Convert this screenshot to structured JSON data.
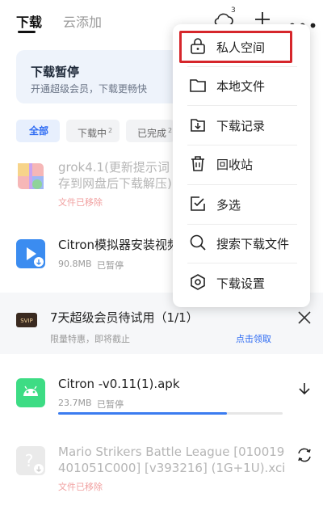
{
  "tabs": {
    "download": "下载",
    "cloud_add": "云添加"
  },
  "header": {
    "cloud_badge": "3"
  },
  "banner": {
    "title": "下载暂停",
    "subtitle": "开通超级会员，下载更畅快"
  },
  "filters": {
    "all": "全部",
    "downloading": "下载中",
    "downloading_count": "2",
    "done": "已完成",
    "done_count": "2"
  },
  "items": [
    {
      "title_line1": "grok4.1(更新提示词，",
      "title_line2": "存到网盘后下载解压)",
      "meta": "文件已移除"
    },
    {
      "title": "Citron模拟器安装视频",
      "size": "90.8MB",
      "status": "已暂停"
    },
    {
      "title": "Citron -v0.11(1).apk",
      "size": "23.7MB",
      "status": "已暂停",
      "progress": 0.75
    },
    {
      "title_line1": "Mario Strikers Battle League [010019",
      "title_line2": "401051C000] [v393216] (1G+1U).xci",
      "meta": "文件已移除"
    }
  ],
  "promo": {
    "badge": "SVIP",
    "title": "7天超级会员待试用（1/1）",
    "subtitle": "限量特惠，即将截止",
    "link": "点击领取"
  },
  "menu": {
    "items": [
      {
        "label": "私人空间",
        "icon": "lock-icon"
      },
      {
        "label": "本地文件",
        "icon": "folder-icon"
      },
      {
        "label": "下载记录",
        "icon": "download-record-icon"
      },
      {
        "label": "回收站",
        "icon": "trash-icon"
      },
      {
        "label": "多选",
        "icon": "multi-select-icon"
      },
      {
        "label": "搜索下载文件",
        "icon": "search-icon"
      },
      {
        "label": "下载设置",
        "icon": "settings-icon"
      }
    ],
    "highlight_color": "#d6262b"
  },
  "colors": {
    "accent": "#2f6cf3",
    "removed": "#f1a0a0",
    "apk": "#3ddc84",
    "video": "#3b8cf0"
  }
}
